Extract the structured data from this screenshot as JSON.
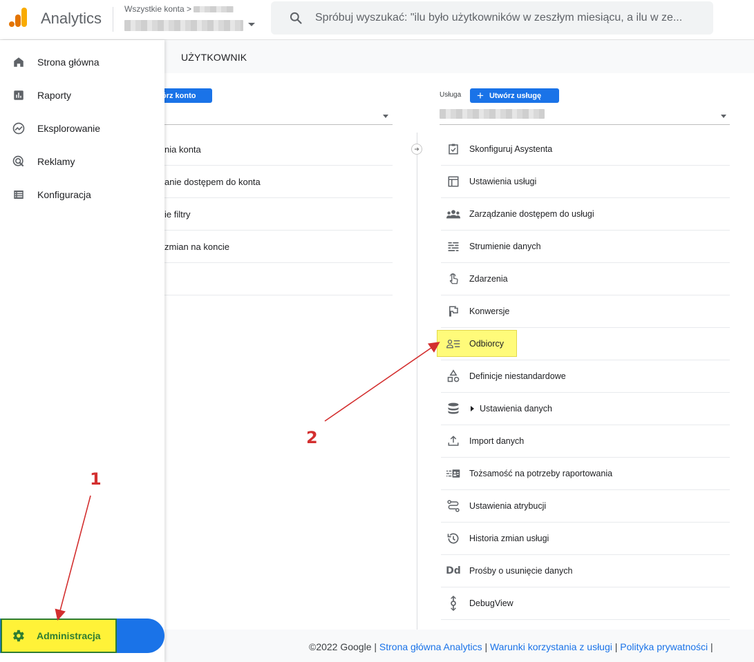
{
  "header": {
    "brand": "Analytics",
    "account_path": "Wszystkie konta",
    "path_sep": ">",
    "search_placeholder": "Spróbuj wyszukać: \"ilu było użytkowników w zeszłym miesiącu, a ilu w ze..."
  },
  "sidebar": {
    "items": [
      {
        "label": "Strona główna",
        "icon": "home-icon"
      },
      {
        "label": "Raporty",
        "icon": "bar-chart-icon"
      },
      {
        "label": "Eksplorowanie",
        "icon": "explore-icon"
      },
      {
        "label": "Reklamy",
        "icon": "ads-icon"
      },
      {
        "label": "Konfiguracja",
        "icon": "list-icon"
      }
    ],
    "admin_label": "Administracja"
  },
  "tabs": {
    "user": "UŻYTKOWNIK"
  },
  "account_column": {
    "create_label": "órz konto",
    "items": [
      "nia konta",
      "anie dostępem do konta",
      "ie filtry",
      "zmian na koncie"
    ]
  },
  "property_column": {
    "label": "Usługa",
    "create_label": "Utwórz usługę",
    "items": [
      {
        "label": "Skonfiguruj Asystenta",
        "icon": "checklist-icon"
      },
      {
        "label": "Ustawienia usługi",
        "icon": "layout-icon"
      },
      {
        "label": "Zarządzanie dostępem do usługi",
        "icon": "people-icon"
      },
      {
        "label": "Strumienie danych",
        "icon": "streams-icon"
      },
      {
        "label": "Zdarzenia",
        "icon": "touch-icon"
      },
      {
        "label": "Konwersje",
        "icon": "flag-icon"
      },
      {
        "label": "Odbiorcy",
        "icon": "audience-icon"
      },
      {
        "label": "Definicje niestandardowe",
        "icon": "shapes-icon"
      },
      {
        "label": "Ustawienia danych",
        "icon": "database-icon"
      },
      {
        "label": "Import danych",
        "icon": "upload-icon"
      },
      {
        "label": "Tożsamość na potrzeby raportowania",
        "icon": "identity-icon"
      },
      {
        "label": "Ustawienia atrybucji",
        "icon": "attribution-icon"
      },
      {
        "label": "Historia zmian usługi",
        "icon": "history-icon"
      },
      {
        "label": "Prośby o usunięcie danych",
        "icon": "dd-icon"
      },
      {
        "label": "DebugView",
        "icon": "debug-icon"
      }
    ]
  },
  "footer": {
    "copyright": "©2022 Google |",
    "link1": "Strona główna Analytics",
    "link2": "Warunki korzystania z usługi",
    "link3": "Polityka prywatności",
    "sep": "|"
  },
  "annotations": {
    "one": "1",
    "two": "2"
  },
  "colors": {
    "accent": "#1a73e8",
    "highlight": "#fffb7a",
    "annotation": "#d32f2f"
  }
}
